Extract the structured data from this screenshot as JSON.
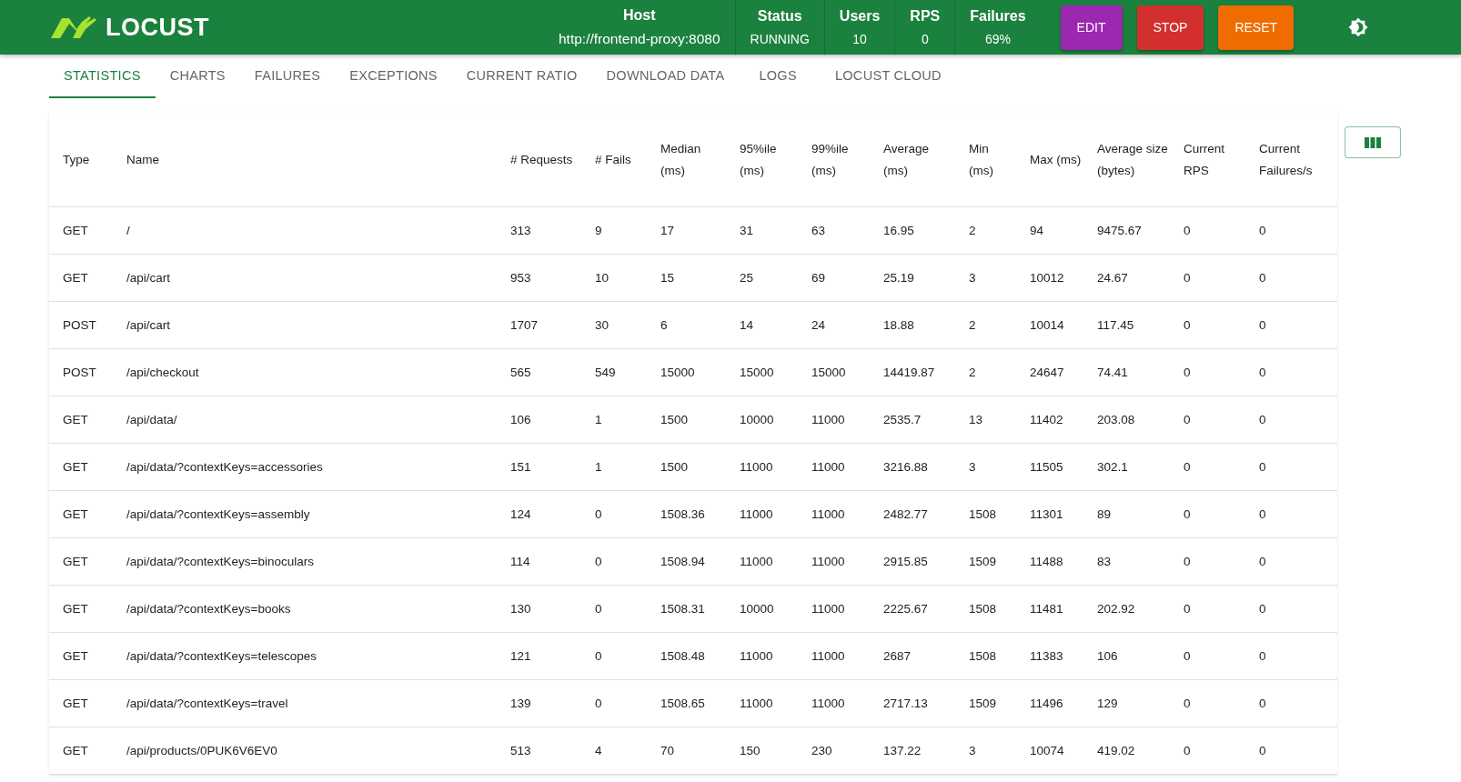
{
  "header": {
    "logo_text": "LOCUST",
    "stats": [
      {
        "label": "Host",
        "value": "http://frontend-proxy:8080"
      },
      {
        "label": "Status",
        "value": "RUNNING"
      },
      {
        "label": "Users",
        "value": "10"
      },
      {
        "label": "RPS",
        "value": "0"
      },
      {
        "label": "Failures",
        "value": "69%"
      }
    ],
    "buttons": [
      {
        "label": "EDIT",
        "kind": "edit"
      },
      {
        "label": "STOP",
        "kind": "stop"
      },
      {
        "label": "RESET",
        "kind": "reset"
      }
    ]
  },
  "tabs": [
    {
      "label": "STATISTICS",
      "selected": true
    },
    {
      "label": "CHARTS",
      "selected": false
    },
    {
      "label": "FAILURES",
      "selected": false
    },
    {
      "label": "EXCEPTIONS",
      "selected": false
    },
    {
      "label": "CURRENT RATIO",
      "selected": false
    },
    {
      "label": "DOWNLOAD DATA",
      "selected": false
    },
    {
      "label": "LOGS",
      "selected": false
    },
    {
      "label": "LOCUST CLOUD",
      "selected": false
    }
  ],
  "table": {
    "columns": [
      "Type",
      "Name",
      "# Requests",
      "# Fails",
      "Median (ms)",
      "95%ile (ms)",
      "99%ile (ms)",
      "Average (ms)",
      "Min (ms)",
      "Max (ms)",
      "Average size (bytes)",
      "Current RPS",
      "Current Failures/s"
    ],
    "rows": [
      [
        "GET",
        "/",
        "313",
        "9",
        "17",
        "31",
        "63",
        "16.95",
        "2",
        "94",
        "9475.67",
        "0",
        "0"
      ],
      [
        "GET",
        "/api/cart",
        "953",
        "10",
        "15",
        "25",
        "69",
        "25.19",
        "3",
        "10012",
        "24.67",
        "0",
        "0"
      ],
      [
        "POST",
        "/api/cart",
        "1707",
        "30",
        "6",
        "14",
        "24",
        "18.88",
        "2",
        "10014",
        "117.45",
        "0",
        "0"
      ],
      [
        "POST",
        "/api/checkout",
        "565",
        "549",
        "15000",
        "15000",
        "15000",
        "14419.87",
        "2",
        "24647",
        "74.41",
        "0",
        "0"
      ],
      [
        "GET",
        "/api/data/",
        "106",
        "1",
        "1500",
        "10000",
        "11000",
        "2535.7",
        "13",
        "11402",
        "203.08",
        "0",
        "0"
      ],
      [
        "GET",
        "/api/data/?contextKeys=accessories",
        "151",
        "1",
        "1500",
        "11000",
        "11000",
        "3216.88",
        "3",
        "11505",
        "302.1",
        "0",
        "0"
      ],
      [
        "GET",
        "/api/data/?contextKeys=assembly",
        "124",
        "0",
        "1508.36",
        "11000",
        "11000",
        "2482.77",
        "1508",
        "11301",
        "89",
        "0",
        "0"
      ],
      [
        "GET",
        "/api/data/?contextKeys=binoculars",
        "114",
        "0",
        "1508.94",
        "11000",
        "11000",
        "2915.85",
        "1509",
        "11488",
        "83",
        "0",
        "0"
      ],
      [
        "GET",
        "/api/data/?contextKeys=books",
        "130",
        "0",
        "1508.31",
        "10000",
        "11000",
        "2225.67",
        "1508",
        "11481",
        "202.92",
        "0",
        "0"
      ],
      [
        "GET",
        "/api/data/?contextKeys=telescopes",
        "121",
        "0",
        "1508.48",
        "11000",
        "11000",
        "2687",
        "1508",
        "11383",
        "106",
        "0",
        "0"
      ],
      [
        "GET",
        "/api/data/?contextKeys=travel",
        "139",
        "0",
        "1508.65",
        "11000",
        "11000",
        "2717.13",
        "1509",
        "11496",
        "129",
        "0",
        "0"
      ],
      [
        "GET",
        "/api/products/0PUK6V6EV0",
        "513",
        "4",
        "70",
        "150",
        "230",
        "137.22",
        "3",
        "10074",
        "419.02",
        "0",
        "0"
      ]
    ]
  }
}
